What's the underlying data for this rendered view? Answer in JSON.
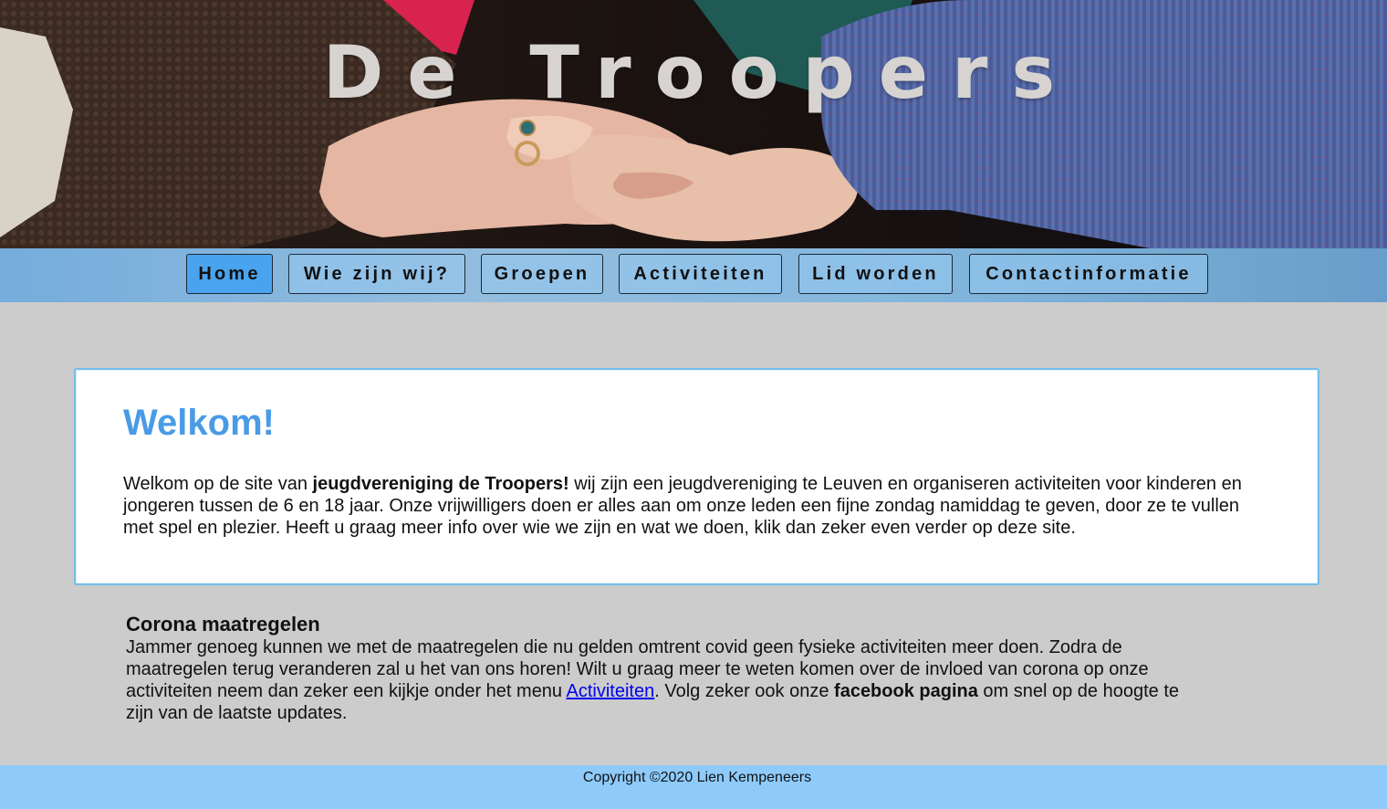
{
  "hero": {
    "title": "De Troopers"
  },
  "nav": {
    "items": [
      {
        "label": "Home",
        "active": true
      },
      {
        "label": "Wie zijn wij?",
        "active": false
      },
      {
        "label": "Groepen",
        "active": false
      },
      {
        "label": "Activiteiten",
        "active": false
      },
      {
        "label": "Lid worden",
        "active": false
      },
      {
        "label": "Contactinformatie",
        "active": false
      }
    ]
  },
  "welcome": {
    "title": "Welkom!",
    "text_before": "Welkom op de site van ",
    "text_bold": "jeugdvereniging de Troopers!",
    "text_after": " wij zijn een jeugdvereniging te Leuven en organiseren activiteiten voor kinderen en jongeren tussen de 6 en 18 jaar. Onze vrijwilligers doen er alles aan om onze leden een fijne zondag namiddag te geven, door ze te vullen met spel en plezier. Heeft u graag meer info over wie we zijn en wat we doen, klik dan zeker even verder op deze site."
  },
  "corona": {
    "title": "Corona maatregelen",
    "text_before": "Jammer genoeg kunnen we met de maatregelen die nu gelden omtrent covid geen fysieke activiteiten meer doen. Zodra de maatregelen terug veranderen zal u het van ons horen! Wilt u graag meer te weten komen over de invloed van corona op onze activiteiten neem dan zeker een kijkje onder het menu ",
    "link_label": "Activiteiten",
    "text_middle": ". Volg zeker ook onze ",
    "text_bold": "facebook pagina",
    "text_after": " om snel op de hoogte te zijn van de laatste updates."
  },
  "footer": {
    "copyright": "Copyright ©2020 Lien Kempeneers"
  },
  "colors": {
    "accent": "#4a9be6",
    "nav_active": "#4aa3ee",
    "footer_bg": "#8ecbfb",
    "page_bg": "#cccccc"
  }
}
